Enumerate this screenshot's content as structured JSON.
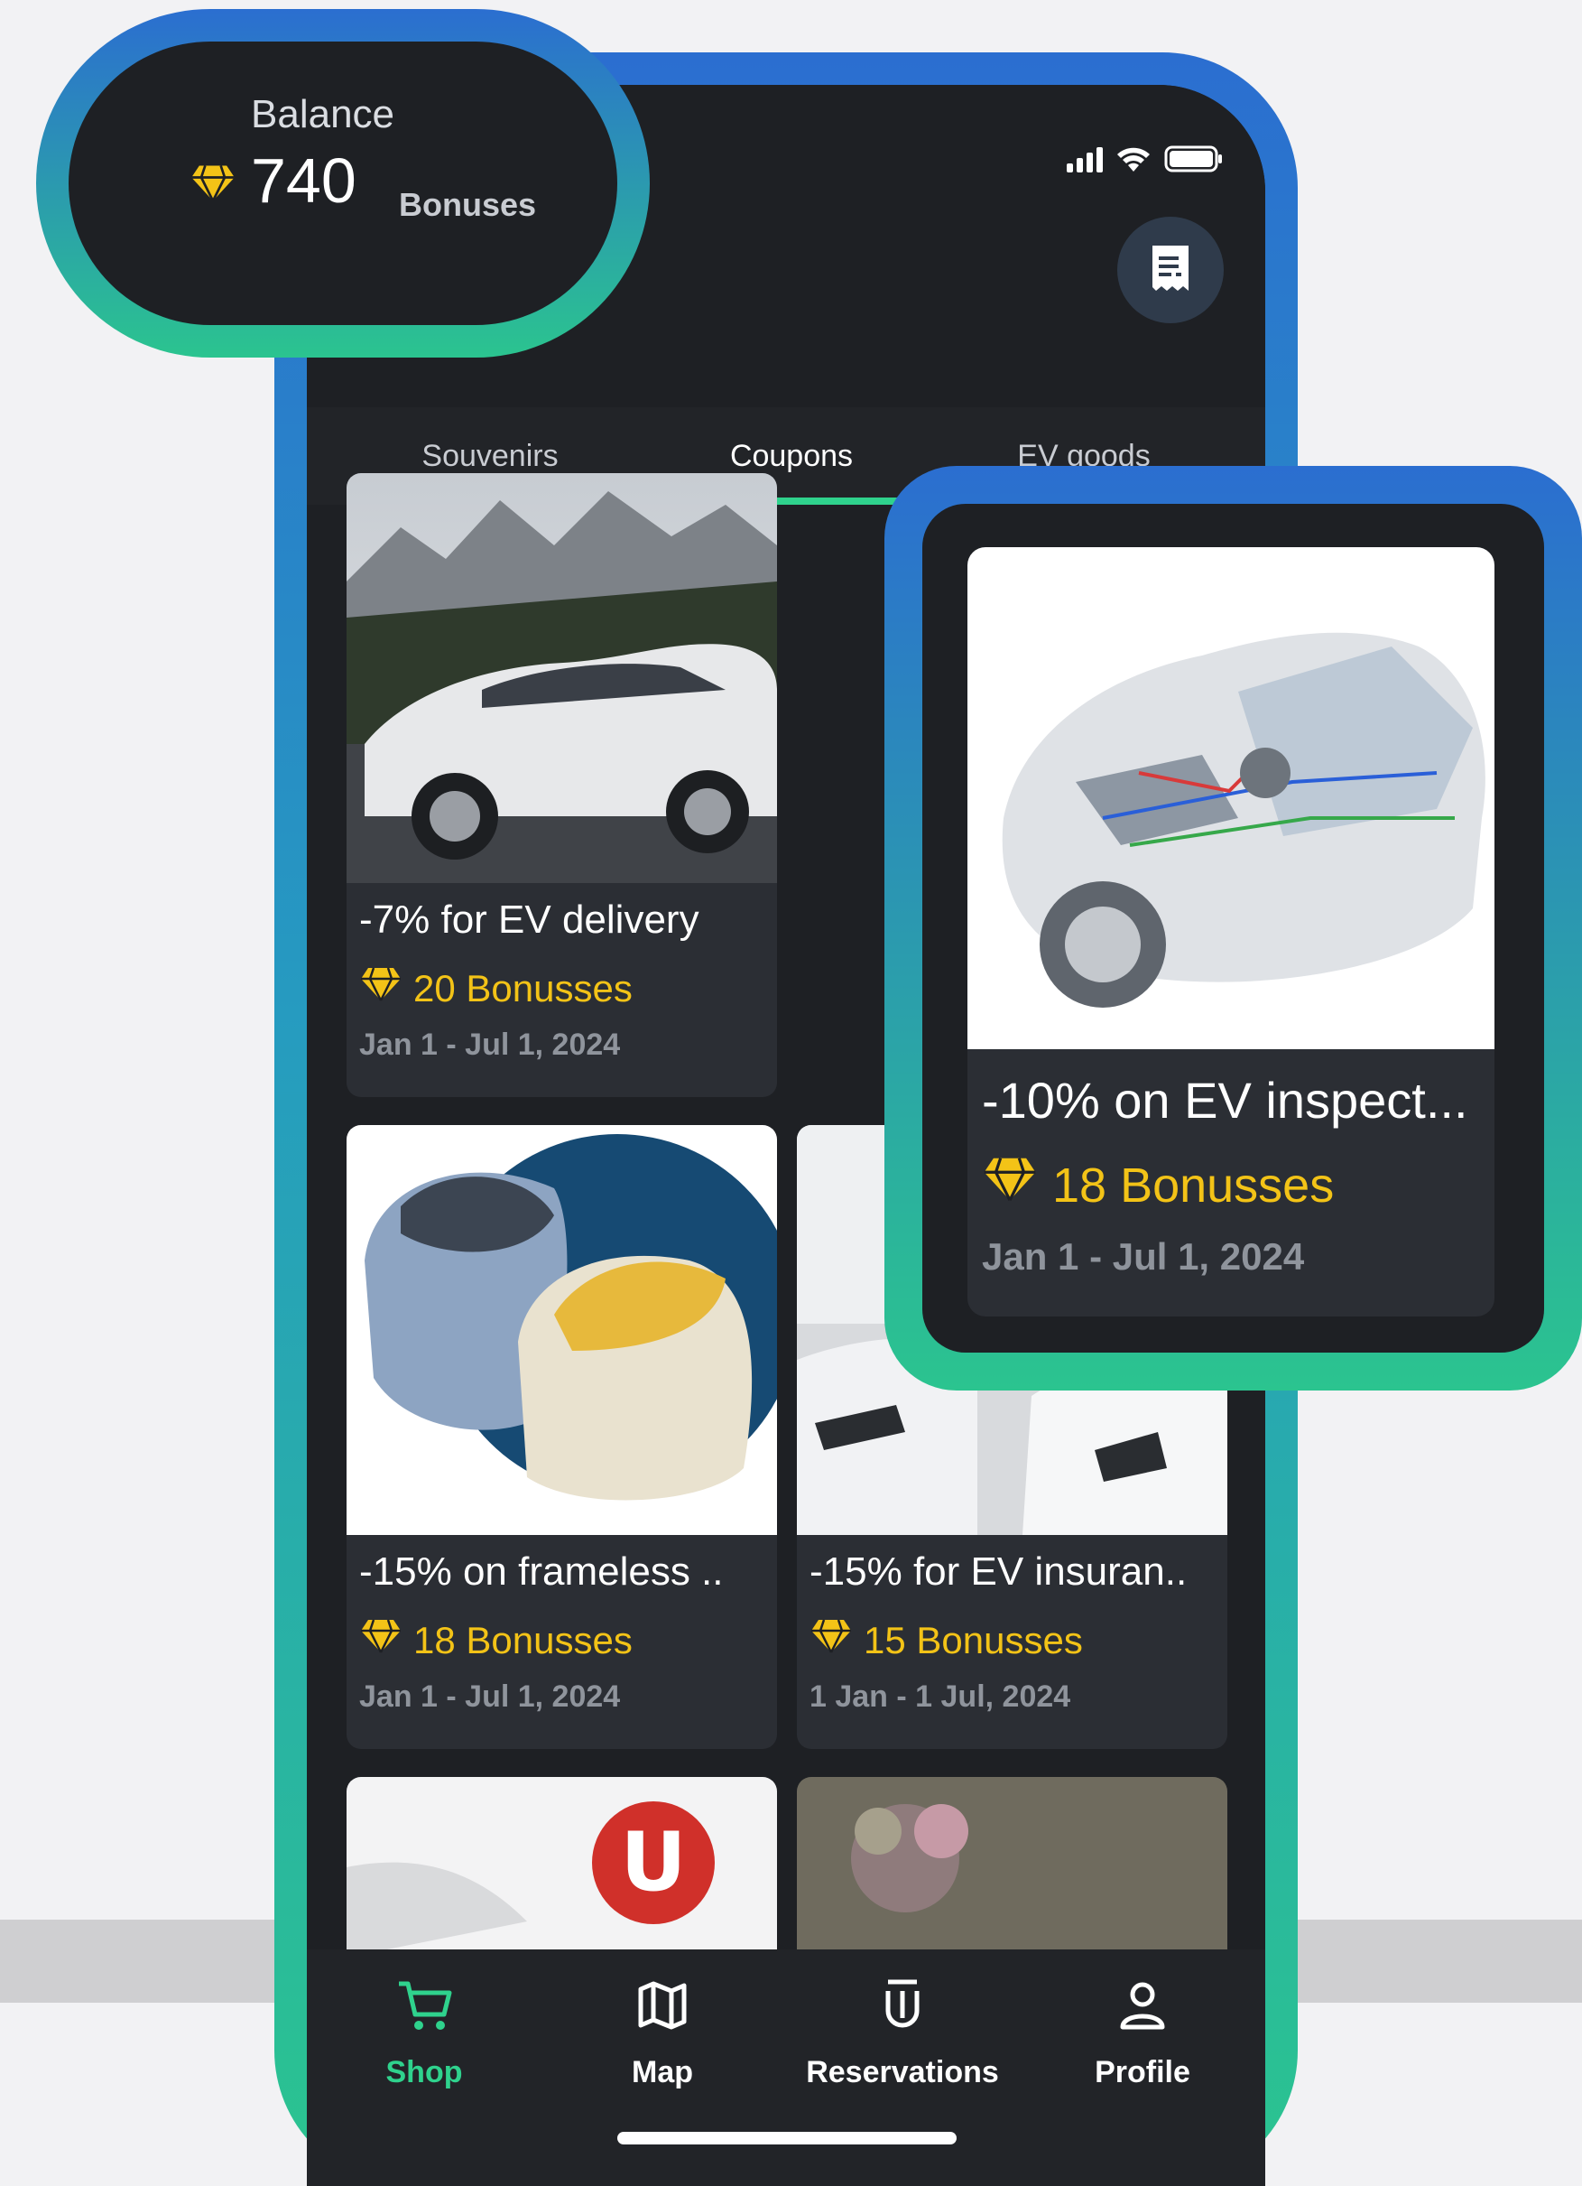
{
  "balance": {
    "label": "Balance",
    "value": "740",
    "unit": "Bonuses"
  },
  "tabs": [
    {
      "label": "Souvenirs"
    },
    {
      "label": "Coupons",
      "active": true
    },
    {
      "label": "EV goods"
    }
  ],
  "cards": [
    {
      "title": "-7% for EV delivery",
      "bonus": "20 Bonusses",
      "dates": "Jan 1 - Jul 1, 2024",
      "image": "car-mountain-image"
    },
    {
      "title": "-15% on frameless ..",
      "bonus": "18 Bonusses",
      "dates": "Jan 1 - Jul 1, 2024",
      "image": "beanbag-chairs-image"
    },
    {
      "title": "-15% for EV insuran..",
      "bonus": "15 Bonusses",
      "dates": "1 Jan - 1 Jul, 2024",
      "image": "white-cars-image"
    },
    {
      "title": "",
      "bonus": "",
      "dates": "",
      "image": "logo-car-image"
    },
    {
      "title": "",
      "bonus": "",
      "dates": "",
      "image": "flowers-stone-image"
    }
  ],
  "highlight": {
    "title": "-10% on EV inspect...",
    "bonus": "18 Bonusses",
    "dates": "Jan 1 - Jul 1, 2024",
    "image": "ev-cutaway-image"
  },
  "nav": [
    {
      "label": "Shop",
      "icon": "cart-icon",
      "active": true
    },
    {
      "label": "Map",
      "icon": "map-icon"
    },
    {
      "label": "Reservations",
      "icon": "u-logo-icon"
    },
    {
      "label": "Profile",
      "icon": "user-icon"
    }
  ],
  "colors": {
    "accent_green": "#2fd28d",
    "bonus_yellow": "#f3c317",
    "frame_blue": "#2b6ed0",
    "dark_bg": "#1e2024"
  }
}
